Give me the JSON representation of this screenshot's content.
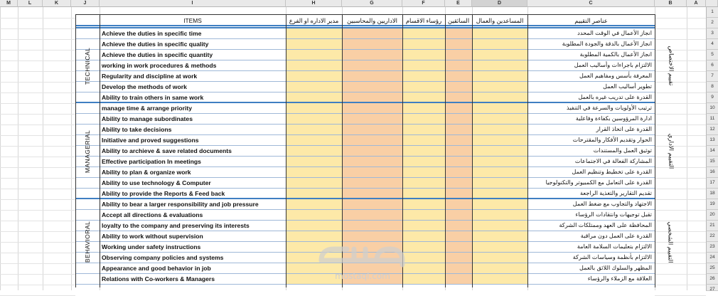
{
  "column_headers": [
    "M",
    "L",
    "K",
    "J",
    "I",
    "H",
    "G",
    "F",
    "E",
    "D",
    "C",
    "B",
    "A"
  ],
  "row_numbers": [
    "1",
    "2",
    "3",
    "4",
    "5",
    "6",
    "7",
    "8",
    "9",
    "10",
    "11",
    "12",
    "13",
    "14",
    "15",
    "16",
    "17",
    "18",
    "19",
    "20",
    "21",
    "22",
    "23",
    "24",
    "25",
    "26",
    "27"
  ],
  "table_header": {
    "items": "ITEMS",
    "dept_manager": "مدير الاداره او الفرع",
    "admins_accountants": "الاداريين والمحاسبين",
    "section_heads": "رؤساء الاقسام",
    "drivers": "السائقين",
    "assistants_workers": "المساعدين والعمال",
    "eval_elements": "عناصر التقييم"
  },
  "categories": [
    {
      "en": "TECHNICAL",
      "ar": "تقييم الاختصاص"
    },
    {
      "en": "MANAGERIAL",
      "ar": "التقييم الاداري"
    },
    {
      "en": "BEHAVIORAL",
      "ar": "التقييم الشخصي"
    }
  ],
  "rows": [
    {
      "en": "Achieve the duties in specific time",
      "ar": "انجاز الأعمال في الوقت المحدد"
    },
    {
      "en": "Achieve the duties in specific quality",
      "ar": "انجاز الأعمال بالدقة والجودة المطلوبة"
    },
    {
      "en": "Achieve the duties in specific quantity",
      "ar": "انجاز الأعمال بالكمية المطلوبة"
    },
    {
      "en": "working in work procedures & methods",
      "ar": "الالتزام باجراءات وأساليب العمل"
    },
    {
      "en": "Regularity and discipline at work",
      "ar": "المعرفة بأسس ومفاهيم العمل"
    },
    {
      "en": "Develop the methods of work",
      "ar": "تطوير أساليب العمل"
    },
    {
      "en": "Ability to train others in same work",
      "ar": "القدرة على تدريب غيره بالعمل"
    },
    {
      "en": "manage time & arrange priority",
      "ar": "ترتيب الأولويات والسرعة في التنفيذ"
    },
    {
      "en": "Ability to manage subordinates",
      "ar": "ادارة المرؤوسين بكفاءة وفاعلية"
    },
    {
      "en": "Ability to take decisions",
      "ar": "القدرة على اتخاذ القرار"
    },
    {
      "en": "Initiative and proved suggestions",
      "ar": "الحوار وتقديم الأفكار والمقترحات"
    },
    {
      "en": "Ability to archieve & save related documents",
      "ar": "توثيق العمل والمستندات"
    },
    {
      "en": "Effective participation In meetings",
      "ar": "المشاركة الفعالة في الاجتماعات"
    },
    {
      "en": "Ability to plan & organize work",
      "ar": "القدرة على تخطيط وتنظيم العمل"
    },
    {
      "en": "Ability to use technology & Computer",
      "ar": "القدرة على التعامل مع الكمبيوتر والتكنولوجيا"
    },
    {
      "en": "Ability to provide the Reports & Feed back",
      "ar": "تقديم التقارير والتغذية الراجعة"
    },
    {
      "en": "Ability to bear a larger responsibility and job pressure",
      "ar": "الاجتهاد والتجاوب مع ضغط العمل"
    },
    {
      "en": "Accept all directions & evaluations",
      "ar": "تقبل توجيهات وانتقادات الرؤساء"
    },
    {
      "en": "loyalty to the company and preserving its interests",
      "ar": "المحافظة على العهد وممتلكات الشركة"
    },
    {
      "en": "Ability to work without supervision",
      "ar": "القدرة على العمل دون مراقبة"
    },
    {
      "en": "Working under safety instructions",
      "ar": "الالتزام بتعليمات السلامة العامة"
    },
    {
      "en": "Observing company policies and systems",
      "ar": "الالتزام بأنظمة وسياسات الشركة"
    },
    {
      "en": "Appearance and good behavior in job",
      "ar": "المظهر والسلوك اللائق بالعمل"
    },
    {
      "en": "Relations with Co-workers & Managers",
      "ar": "العلاقة مع الزملاء والرؤساء"
    }
  ],
  "watermark": {
    "logo": "مستقل",
    "url": "mostaql.com"
  },
  "colors": {
    "yellow_fill": "#fde9a8",
    "orange_fill": "#f9cfa5",
    "header_bar": "#3f7fc2"
  }
}
